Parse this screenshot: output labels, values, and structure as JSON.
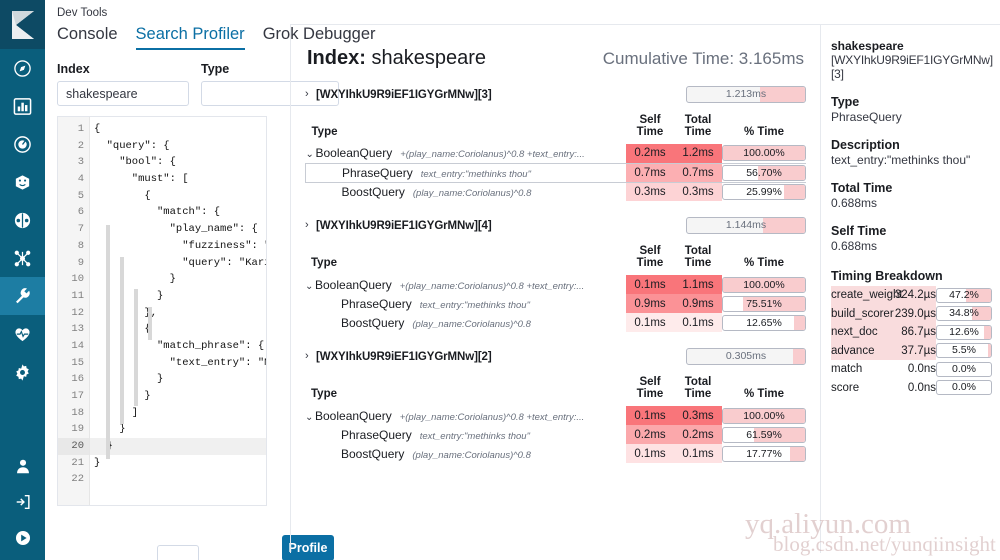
{
  "app": {
    "title": "Dev Tools",
    "logo_icon": "kibana-logo-icon"
  },
  "tabs": [
    {
      "label": "Console",
      "active": false
    },
    {
      "label": "Search Profiler",
      "active": true
    },
    {
      "label": "Grok Debugger",
      "active": false
    }
  ],
  "nav_icons": [
    "discover-compass-icon",
    "visualize-bar-chart-icon",
    "dashboard-clock-icon",
    "apm-cube-icon",
    "graph-network-icon",
    "machine-learning-icon",
    "dev-tools-wrench-icon",
    "monitoring-heartbeat-icon",
    "management-gear-icon"
  ],
  "nav_bottom_icons": [
    "user-avatar-icon",
    "logout-icon",
    "play-circle-icon"
  ],
  "query_panel": {
    "index_label": "Index",
    "index_value": "shakespeare",
    "index_placeholder": "",
    "type_label": "Type",
    "type_value": "",
    "type_placeholder": "",
    "profile_button": "Profile",
    "editor": {
      "active_line": 20,
      "lines": [
        "{",
        "  \"query\": {",
        "    \"bool\": {",
        "      \"must\": [",
        "        {",
        "          \"match\": {",
        "            \"play_name\": {",
        "              \"fuzziness\": \"AUTO\",",
        "              \"query\": \"Kariolanus\"",
        "            }",
        "          }",
        "        },",
        "        {",
        "          \"match_phrase\": {",
        "            \"text_entry\": \"Methinks",
        "          }",
        "        }",
        "      ]",
        "    }",
        "  }",
        "}",
        ""
      ]
    }
  },
  "results": {
    "index_prefix": "Index:",
    "index_name": "shakespeare",
    "cumulative_time": "Cumulative Time: 3.165ms",
    "columns": {
      "type": "Type",
      "self_time_l1": "Self",
      "self_time_l2": "Time",
      "total_time_l1": "Total",
      "total_time_l2": "Time",
      "pct_time": "% Time"
    },
    "shards": [
      {
        "id": "[WXYIhkU9R9iEF1IGYGrMNw][3]",
        "caret": "›",
        "time_label": "1.213ms",
        "time_fill_pct": 38,
        "rows": [
          {
            "caret": "⌄",
            "type": "BooleanQuery",
            "desc": "+(play_name:Coriolanus)^0.8 +text_entry:...",
            "self": "0.2ms",
            "total": "1.2ms",
            "pct": "100.00%",
            "pct_fill": 100,
            "self_shade": 0.95,
            "total_shade": 0.95,
            "selected": false,
            "indent": 0
          },
          {
            "caret": "",
            "type": "PhraseQuery",
            "desc": "text_entry:\"methinks thou\"",
            "self": "0.7ms",
            "total": "0.7ms",
            "pct": "56.70%",
            "pct_fill": 57,
            "self_shade": 0.55,
            "total_shade": 0.55,
            "selected": true,
            "indent": 1
          },
          {
            "caret": "",
            "type": "BoostQuery",
            "desc": "(play_name:Coriolanus)^0.8",
            "self": "0.3ms",
            "total": "0.3ms",
            "pct": "25.99%",
            "pct_fill": 26,
            "self_shade": 0.3,
            "total_shade": 0.3,
            "selected": false,
            "indent": 1
          }
        ]
      },
      {
        "id": "[WXYIhkU9R9iEF1IGYGrMNw][4]",
        "caret": "›",
        "time_label": "1.144ms",
        "time_fill_pct": 36,
        "rows": [
          {
            "caret": "⌄",
            "type": "BooleanQuery",
            "desc": "+(play_name:Coriolanus)^0.8 +text_entry:...",
            "self": "0.1ms",
            "total": "1.1ms",
            "pct": "100.00%",
            "pct_fill": 100,
            "self_shade": 0.95,
            "total_shade": 0.95,
            "selected": false,
            "indent": 0
          },
          {
            "caret": "",
            "type": "PhraseQuery",
            "desc": "text_entry:\"methinks thou\"",
            "self": "0.9ms",
            "total": "0.9ms",
            "pct": "75.51%",
            "pct_fill": 76,
            "self_shade": 0.75,
            "total_shade": 0.75,
            "selected": false,
            "indent": 1
          },
          {
            "caret": "",
            "type": "BoostQuery",
            "desc": "(play_name:Coriolanus)^0.8",
            "self": "0.1ms",
            "total": "0.1ms",
            "pct": "12.65%",
            "pct_fill": 13,
            "self_shade": 0.14,
            "total_shade": 0.14,
            "selected": false,
            "indent": 1
          }
        ]
      },
      {
        "id": "[WXYIhkU9R9iEF1IGYGrMNw][2]",
        "caret": "›",
        "time_label": "0.305ms",
        "time_fill_pct": 10,
        "rows": [
          {
            "caret": "⌄",
            "type": "BooleanQuery",
            "desc": "+(play_name:Coriolanus)^0.8 +text_entry:...",
            "self": "0.1ms",
            "total": "0.3ms",
            "pct": "100.00%",
            "pct_fill": 100,
            "self_shade": 0.95,
            "total_shade": 0.95,
            "selected": false,
            "indent": 0
          },
          {
            "caret": "",
            "type": "PhraseQuery",
            "desc": "text_entry:\"methinks thou\"",
            "self": "0.2ms",
            "total": "0.2ms",
            "pct": "61.59%",
            "pct_fill": 62,
            "self_shade": 0.6,
            "total_shade": 0.6,
            "selected": false,
            "indent": 1
          },
          {
            "caret": "",
            "type": "BoostQuery",
            "desc": "(play_name:Coriolanus)^0.8",
            "self": "0.1ms",
            "total": "0.1ms",
            "pct": "17.77%",
            "pct_fill": 18,
            "self_shade": 0.2,
            "total_shade": 0.2,
            "selected": false,
            "indent": 1
          }
        ]
      }
    ]
  },
  "detail": {
    "shard_index": "shakespeare",
    "shard_id": "[WXYIhkU9R9iEF1IGYGrMNw][3]",
    "type_label": "Type",
    "type_value": "PhraseQuery",
    "description_label": "Description",
    "description_value": "text_entry:\"methinks thou\"",
    "total_time_label": "Total Time",
    "total_time_value": "0.688ms",
    "self_time_label": "Self Time",
    "self_time_value": "0.688ms",
    "breakdown_label": "Timing Breakdown",
    "breakdown": [
      {
        "name": "create_weight",
        "time": "324.2µs",
        "pct": "47.2%",
        "fill": 47,
        "highlight": true
      },
      {
        "name": "build_scorer",
        "time": "239.0µs",
        "pct": "34.8%",
        "fill": 35,
        "highlight": true
      },
      {
        "name": "next_doc",
        "time": "86.7µs",
        "pct": "12.6%",
        "fill": 13,
        "highlight": true
      },
      {
        "name": "advance",
        "time": "37.7µs",
        "pct": "5.5%",
        "fill": 6,
        "highlight": true
      },
      {
        "name": "match",
        "time": "0.0ns",
        "pct": "0.0%",
        "fill": 0,
        "highlight": false
      },
      {
        "name": "score",
        "time": "0.0ns",
        "pct": "0.0%",
        "fill": 0,
        "highlight": false
      }
    ]
  },
  "watermark": {
    "line1": "yq.aliyun.com",
    "line2": "blog.csdn.net/yunqiinsight"
  },
  "colors": {
    "nav_bg": "#0a5e7c",
    "nav_active": "#1d7da3",
    "accent": "#0b6fa4",
    "heat_pink": "#f9ccce",
    "heat_red": "#f9a0a4"
  }
}
